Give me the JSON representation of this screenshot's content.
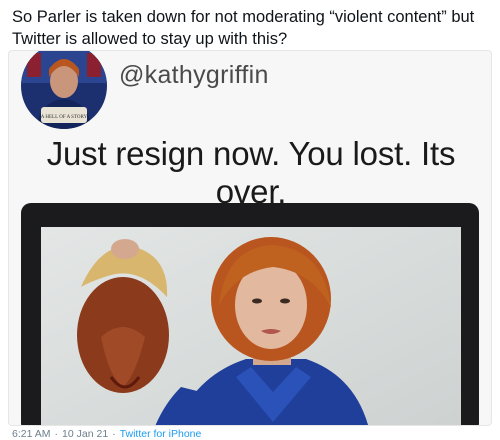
{
  "tweet": {
    "text": "So Parler is taken down for not moderating “violent content” but Twitter is allowed to stay up with this?"
  },
  "embedded_screenshot": {
    "handle": "@kathygriffin",
    "headline": "Just resign now. You lost. Its over.",
    "avatar_caption": "A HELL OF A STORY"
  },
  "footer": {
    "time": "6:21 AM",
    "separator": "·",
    "date": "10 Jan 21",
    "source": "Twitter for iPhone"
  },
  "colors": {
    "text": "#0f1419",
    "source_link": "#1d9bf0",
    "meta": "#6e7f8c",
    "dress_blue": "#1f3f9a",
    "hair": "#b9561f"
  }
}
